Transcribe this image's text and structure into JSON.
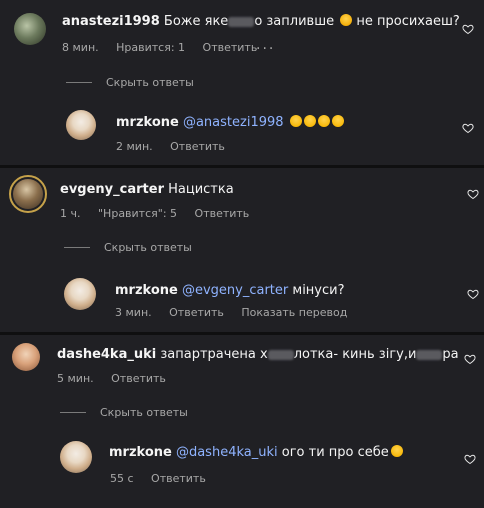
{
  "comments": [
    {
      "user": "anastezi1998",
      "text_before": "Боже яке",
      "text_after": "о запливше",
      "text_end": "не просихаеш?",
      "time": "8 мин.",
      "likes": "Нравится: 1",
      "reply": "Ответить",
      "more": "...",
      "toggle": "Скрыть ответы",
      "replies": [
        {
          "user": "mrzkone",
          "mention": "@anastezi1998",
          "text": "",
          "time": "2 мин.",
          "reply": "Ответить"
        }
      ]
    },
    {
      "user": "evgeny_carter",
      "text": "Нацистка",
      "time": "1 ч.",
      "likes": "\"Нравится\": 5",
      "reply": "Ответить",
      "toggle": "Скрыть ответы",
      "replies": [
        {
          "user": "mrzkone",
          "mention": "@evgeny_carter",
          "text": "мінуси?",
          "time": "3 мин.",
          "reply": "Ответить",
          "translate": "Показать перевод"
        }
      ]
    },
    {
      "user": "dashe4ka_uki",
      "text_before": "запартрачена х",
      "text_after": "лотка- кинь зігу,и",
      "text_end": "ра",
      "time": "5 мин.",
      "reply": "Ответить",
      "toggle": "Скрыть ответы",
      "replies": [
        {
          "user": "mrzkone",
          "mention": "@dashe4ka_uki",
          "text": "ого ти про себе",
          "time": "55 с",
          "reply": "Ответить"
        }
      ]
    }
  ],
  "colors": {
    "background": "#202024",
    "mention": "#8fb3ff",
    "meta": "#a8a8a8"
  },
  "icons": {
    "like": "heart-icon"
  }
}
